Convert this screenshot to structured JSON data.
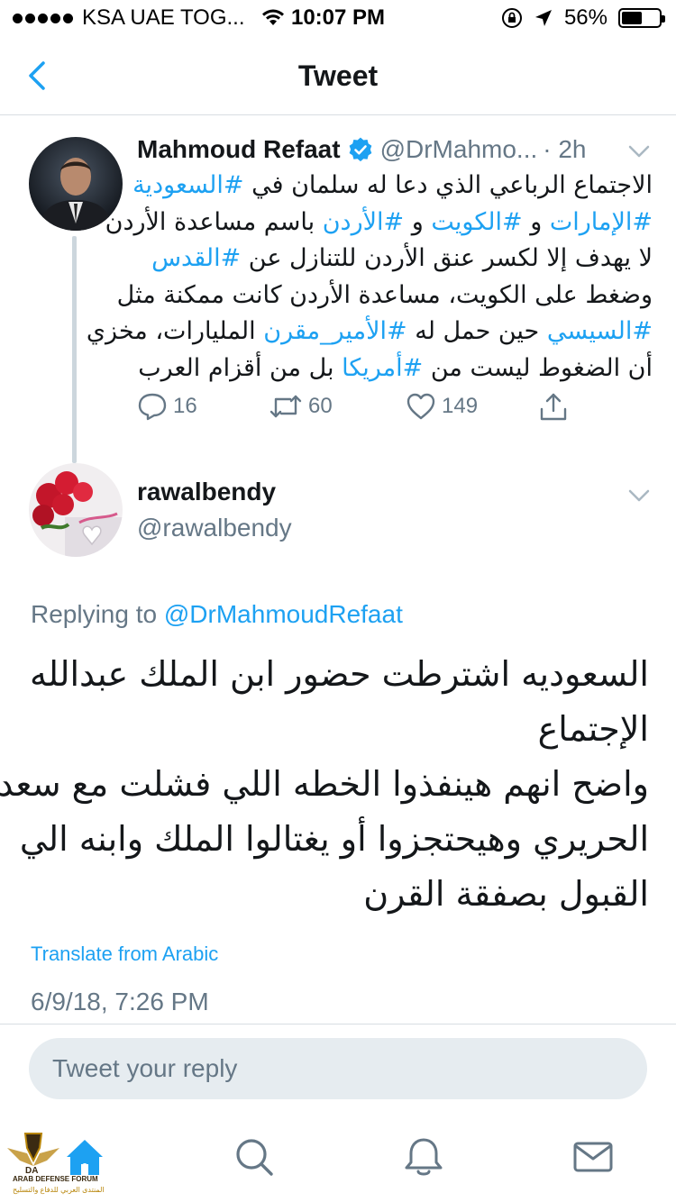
{
  "status_bar": {
    "carrier": "KSA UAE TOG...",
    "time": "10:07 PM",
    "battery_pct": "56%",
    "battery_level": 0.56
  },
  "nav": {
    "title": "Tweet"
  },
  "parent_tweet": {
    "name": "Mahmoud Refaat",
    "handle": "@DrMahmo...",
    "time": "· 2h",
    "verified": true,
    "text_lines": [
      [
        {
          "t": "الاجتماع الرباعي الذي دعا له سلمان في ",
          "tag": false
        },
        {
          "t": "#السعودية",
          "tag": true
        }
      ],
      [
        {
          "t": "#الإمارات",
          "tag": true
        },
        {
          "t": " و ",
          "tag": false
        },
        {
          "t": "#الكويت",
          "tag": true
        },
        {
          "t": " و ",
          "tag": false
        },
        {
          "t": "#الأردن",
          "tag": true
        },
        {
          "t": " باسم مساعدة الأردن",
          "tag": false
        }
      ],
      [
        {
          "t": "لا يهدف إلا لكسر عنق الأردن للتنازل عن ",
          "tag": false
        },
        {
          "t": "#القدس",
          "tag": true
        }
      ],
      [
        {
          "t": "وضغط على الكويت، مساعدة الأردن كانت ممكنة مثل",
          "tag": false
        }
      ],
      [
        {
          "t": "#السيسي",
          "tag": true
        },
        {
          "t": " حين حمل له ",
          "tag": false
        },
        {
          "t": "#الأمير_مقرن",
          "tag": true
        },
        {
          "t": " المليارات، مخزي",
          "tag": false
        }
      ],
      [
        {
          "t": "أن الضغوط ليست من ",
          "tag": false
        },
        {
          "t": "#أمريكا",
          "tag": true
        },
        {
          "t": " بل من أقزام العرب",
          "tag": false
        }
      ]
    ],
    "replies": "16",
    "retweets": "60",
    "likes": "149"
  },
  "reply_tweet": {
    "name": "rawalbendy",
    "handle": "@rawalbendy",
    "replying_prefix": "Replying to ",
    "replying_mention": "@DrMahmoudRefaat",
    "text_lines": [
      "السعوديه اشترطت حضور ابن الملك عبدالله",
      "الإجتماع",
      "واضح انهم هينفذوا الخطه اللي فشلت مع سعد",
      "الحريري وهيحتجزوا أو يغتالوا الملك وابنه الي",
      "القبول بصفقة القرن"
    ],
    "translate_label": "Translate from Arabic",
    "timestamp": "6/9/18, 7:26 PM"
  },
  "compose": {
    "placeholder": "Tweet your reply"
  },
  "tab_bar": {
    "tabs": [
      "home-icon",
      "search-icon",
      "notifications-icon",
      "messages-icon"
    ]
  },
  "watermark": {
    "line1": "ARAB DEFENSE FORUM",
    "line2": "المنتدى العربي للدفاع والتسليح"
  },
  "colors": {
    "accent": "#1da1f2",
    "muted": "#657786",
    "text": "#14171a"
  }
}
